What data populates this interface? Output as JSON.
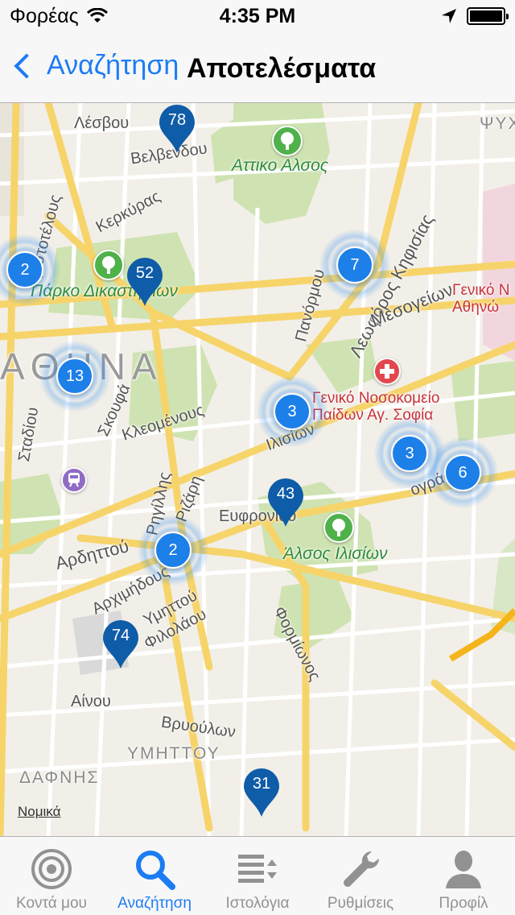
{
  "status_bar": {
    "carrier": "Φορέας",
    "time": "4:35 PM"
  },
  "nav": {
    "back_label": "Αναζήτηση",
    "title": "Αποτελέσματα"
  },
  "map": {
    "labels": {
      "lesvou": "Λέσβου",
      "velveniou": "Βελβενδου",
      "attiko_alsos": "Αττικο Αλσος",
      "kerkyras": "Κερκύρας",
      "aristotelous": "Αριστοτέλους",
      "parko_dikastirion": "Πάρκο Δικαστηρίων",
      "athina": "ΑΘΗΝΑ",
      "panormou": "Πανόρμου",
      "kifisias": "Λεωφόρος Κηφισίας",
      "mesogeion": "Μεσογείων",
      "geniko_n": "Γενικό Ν\nΑθηνώ",
      "geniko_paidon": "Γενικό Νοσοκομείο\nΠαίδων Αγ. Σοφία",
      "stadiou": "Σταδίου",
      "skoufa": "Σκουφά",
      "kleomenous": "Κλεομένους",
      "ilision": "Ιλισίων",
      "rigillis": "Ρηγίλλης",
      "rizari": "Ριζάρη",
      "efroniou": "Ευφρονίου",
      "alsos_ilision": "Άλσος Ιλισίων",
      "ardittou": "Αρδηττού",
      "archimidous": "Αρχιμήδους",
      "ymittou": "Υμηττού",
      "filolaou": "Φιλολάου",
      "formionos": "Φορμίωνος",
      "ainou": "Αίνου",
      "vryoulon": "Βρυούλων",
      "ymittou_area": "ΥΜΗΤΤΟΥ",
      "dafnis": "ΔΑΦΝΗΣ",
      "psych": "ΨΥΧ",
      "geografou": "ογράφου"
    },
    "pins": [
      "78",
      "52",
      "43",
      "74",
      "31"
    ],
    "clusters": [
      "2",
      "7",
      "13",
      "3",
      "3",
      "6",
      "2"
    ],
    "legal": "Νομικά"
  },
  "tabs": [
    {
      "label": "Κοντά μου",
      "icon": "target-icon",
      "active": false
    },
    {
      "label": "Αναζήτηση",
      "icon": "search-icon",
      "active": true
    },
    {
      "label": "Ιστολόγια",
      "icon": "list-icon",
      "active": false
    },
    {
      "label": "Ρυθμίσεις",
      "icon": "wrench-icon",
      "active": false
    },
    {
      "label": "Προφίλ",
      "icon": "person-icon",
      "active": false
    }
  ],
  "colors": {
    "accent": "#1c7cf4",
    "pin": "#0f5ca8",
    "cluster": "#1d7fe8",
    "park": "#4fb14a",
    "road": "#f6d46a"
  }
}
